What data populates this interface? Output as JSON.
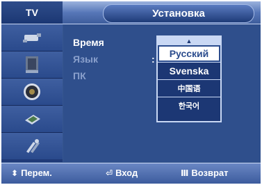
{
  "header": {
    "tab_label": "TV",
    "title": "Установка"
  },
  "sidebar": {
    "icons": [
      "input-icon",
      "picture-icon",
      "sound-icon",
      "channel-icon",
      "setup-icon"
    ]
  },
  "menu": {
    "items": [
      {
        "label": "Время",
        "state": "active"
      },
      {
        "label": "Язык",
        "state": "dim"
      },
      {
        "label": "ПК",
        "state": "dim"
      }
    ],
    "colon": ":"
  },
  "dropdown": {
    "up_arrow": "▲",
    "options": [
      "Русский",
      "Svenska",
      "中国语",
      "한국어"
    ],
    "selected": "Русский"
  },
  "footer": {
    "move_icon": "⬍",
    "move_label": "Перем.",
    "enter_icon": "⏎",
    "enter_label": "Вход",
    "return_icon": "Ⅲ",
    "return_label": "Возврат"
  }
}
